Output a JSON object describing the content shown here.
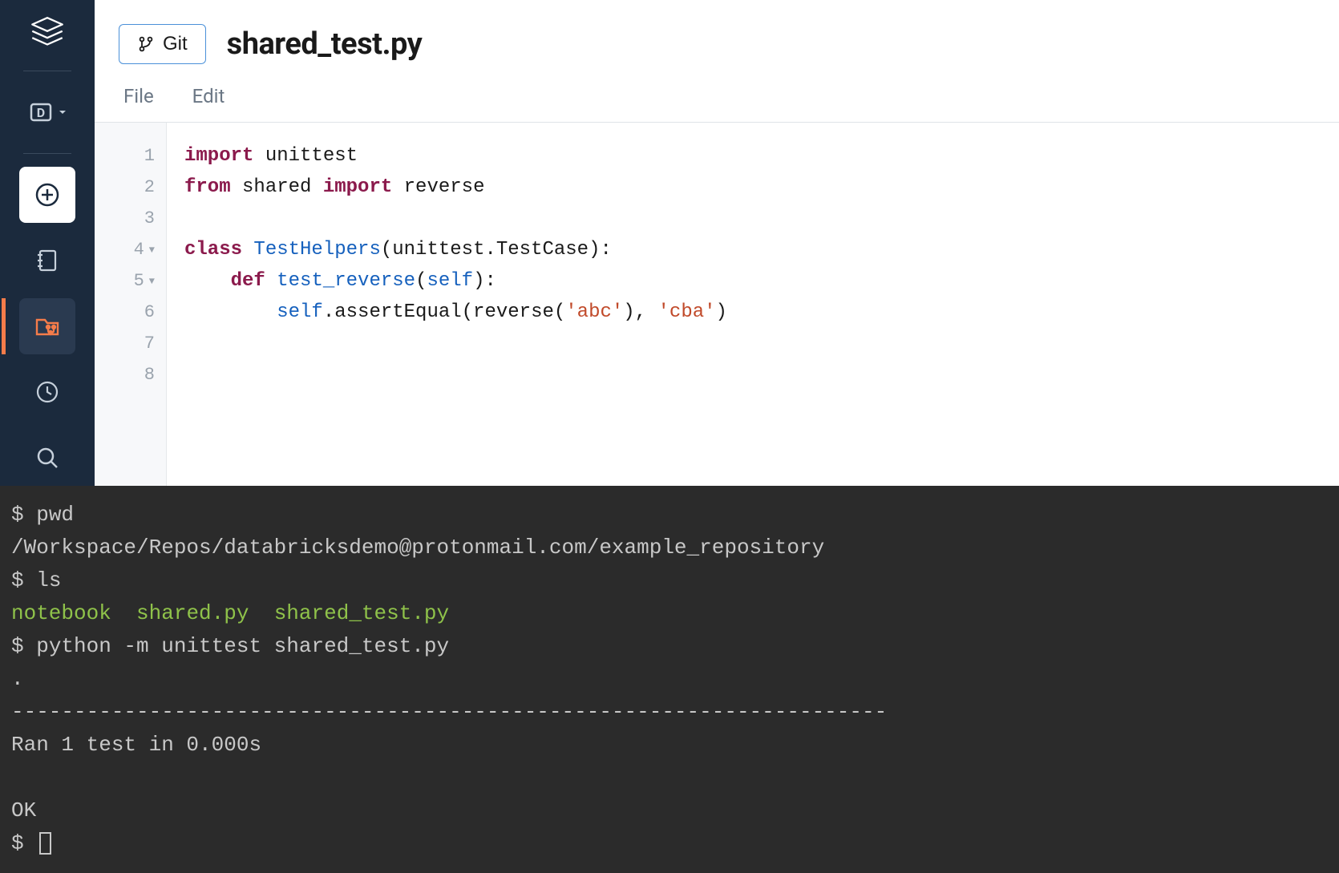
{
  "header": {
    "git_label": "Git",
    "title": "shared_test.py"
  },
  "menu": {
    "file": "File",
    "edit": "Edit"
  },
  "gutter": [
    "1",
    "2",
    "3",
    "4",
    "5",
    "6",
    "7",
    "8"
  ],
  "code": {
    "l1": {
      "kw1": "import",
      "t1": " unittest"
    },
    "l2": {
      "kw1": "from",
      "t1": " shared ",
      "kw2": "import",
      "t2": " reverse"
    },
    "l4": {
      "kw1": "class",
      "cls": " TestHelpers",
      "t1": "(unittest.TestCase):"
    },
    "l5": {
      "indent": "    ",
      "kw1": "def",
      "fn": " test_reverse",
      "t1": "(",
      "self": "self",
      "t2": "):"
    },
    "l6": {
      "indent": "        ",
      "self": "self",
      "t1": ".assertEqual(reverse(",
      "s1": "'abc'",
      "t2": "), ",
      "s2": "'cba'",
      "t3": ")"
    }
  },
  "terminal": {
    "prompt": "$ ",
    "cmd1": "pwd",
    "out1": "/Workspace/Repos/databricksdemo@protonmail.com/example_repository",
    "cmd2": "ls",
    "ls1": "notebook",
    "ls2": "shared.py",
    "ls3": "shared_test.py",
    "cmd3": "python -m unittest shared_test.py",
    "dot": ".",
    "hr": "----------------------------------------------------------------------",
    "ran": "Ran 1 test in 0.000s",
    "ok": "OK"
  }
}
